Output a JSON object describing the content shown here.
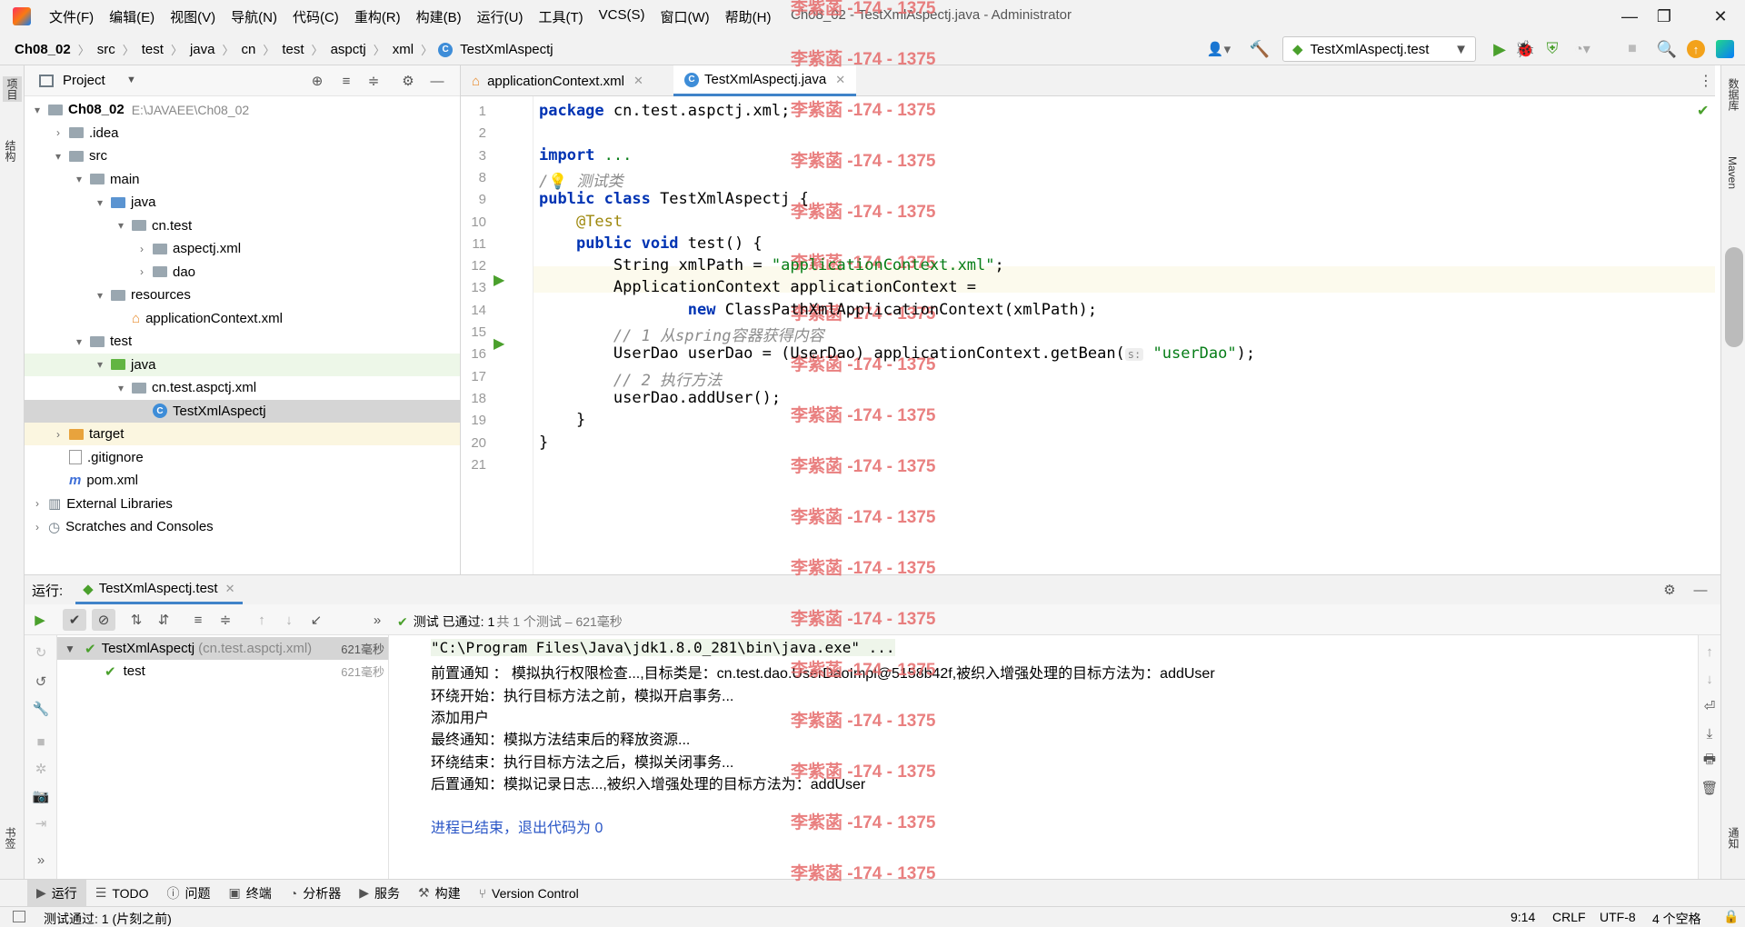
{
  "titlebar": {
    "menu": [
      "文件(F)",
      "编辑(E)",
      "视图(V)",
      "导航(N)",
      "代码(C)",
      "重构(R)",
      "构建(B)",
      "运行(U)",
      "工具(T)",
      "VCS(S)",
      "窗口(W)",
      "帮助(H)"
    ],
    "window_title": "Ch08_02 - TestXmlAspectj.java - Administrator"
  },
  "navbar": {
    "breadcrumbs": [
      "Ch08_02",
      "src",
      "test",
      "java",
      "cn",
      "test",
      "aspctj",
      "xml",
      "TestXmlAspectj"
    ],
    "run_config": "TestXmlAspectj.test"
  },
  "left_stripe": {
    "project_tab": "项目",
    "structure_tab": "结构",
    "bookmarks_tab": "书签"
  },
  "right_stripe": {
    "database_tab": "数据库",
    "maven_tab": "Maven",
    "notifications_tab": "通知"
  },
  "project": {
    "header": "Project",
    "tree": [
      {
        "label": "Ch08_02",
        "extra": "E:\\JAVAEE\\Ch08_02",
        "level": 0,
        "arrow": "down",
        "icon": "module-folder",
        "bold": true
      },
      {
        "label": ".idea",
        "level": 1,
        "arrow": "right",
        "icon": "folder"
      },
      {
        "label": "src",
        "level": 1,
        "arrow": "down",
        "icon": "folder"
      },
      {
        "label": "main",
        "level": 2,
        "arrow": "down",
        "icon": "folder"
      },
      {
        "label": "java",
        "level": 3,
        "arrow": "down",
        "icon": "source-folder"
      },
      {
        "label": "cn.test",
        "level": 4,
        "arrow": "down",
        "icon": "package"
      },
      {
        "label": "aspectj.xml",
        "level": 5,
        "arrow": "right",
        "icon": "package"
      },
      {
        "label": "dao",
        "level": 5,
        "arrow": "right",
        "icon": "package"
      },
      {
        "label": "resources",
        "level": 3,
        "arrow": "down",
        "icon": "resources-folder"
      },
      {
        "label": "applicationContext.xml",
        "level": 4,
        "arrow": "",
        "icon": "xml-file"
      },
      {
        "label": "test",
        "level": 2,
        "arrow": "down",
        "icon": "folder"
      },
      {
        "label": "java",
        "level": 3,
        "arrow": "down",
        "icon": "test-folder",
        "highlight": "green"
      },
      {
        "label": "cn.test.aspctj.xml",
        "level": 4,
        "arrow": "down",
        "icon": "package"
      },
      {
        "label": "TestXmlAspectj",
        "level": 5,
        "arrow": "",
        "icon": "java-class",
        "selected": true
      },
      {
        "label": "target",
        "level": 1,
        "arrow": "right",
        "icon": "excluded-folder",
        "highlight": "yellow"
      },
      {
        "label": ".gitignore",
        "level": 1,
        "arrow": "",
        "icon": "file"
      },
      {
        "label": "pom.xml",
        "level": 1,
        "arrow": "",
        "icon": "maven-file"
      },
      {
        "label": "External Libraries",
        "level": 0,
        "arrow": "right",
        "icon": "libraries"
      },
      {
        "label": "Scratches and Consoles",
        "level": 0,
        "arrow": "right",
        "icon": "scratches"
      }
    ]
  },
  "editor": {
    "tabs": [
      {
        "label": "applicationContext.xml",
        "active": false
      },
      {
        "label": "TestXmlAspectj.java",
        "active": true
      }
    ],
    "lines": [
      {
        "num": "1",
        "parts": [
          {
            "t": "package ",
            "c": "kw"
          },
          {
            "t": "cn.test.aspctj.xml;",
            "c": ""
          }
        ]
      },
      {
        "num": "2",
        "parts": []
      },
      {
        "num": "3",
        "parts": [
          {
            "t": "import ",
            "c": "kw"
          },
          {
            "t": "...",
            "c": "str"
          }
        ]
      },
      {
        "num": "8",
        "parts": [
          {
            "t": "/",
            "c": "cmt"
          },
          {
            "t": "💡",
            "c": ""
          },
          {
            "t": " 测试类",
            "c": "cmt"
          }
        ]
      },
      {
        "num": "9",
        "parts": [
          {
            "t": "public class ",
            "c": "kw"
          },
          {
            "t": "TestXmlAspectj {",
            "c": ""
          }
        ]
      },
      {
        "num": "10",
        "parts": [
          {
            "t": "    ",
            "c": ""
          },
          {
            "t": "@Test",
            "c": "ann"
          }
        ]
      },
      {
        "num": "11",
        "parts": [
          {
            "t": "    ",
            "c": ""
          },
          {
            "t": "public void ",
            "c": "kw"
          },
          {
            "t": "test() {",
            "c": ""
          }
        ]
      },
      {
        "num": "12",
        "parts": [
          {
            "t": "        String xmlPath = ",
            "c": ""
          },
          {
            "t": "\"applicationContext.xml\"",
            "c": "str"
          },
          {
            "t": ";",
            "c": ""
          }
        ]
      },
      {
        "num": "13",
        "parts": [
          {
            "t": "        ApplicationContext applicationContext =",
            "c": ""
          }
        ]
      },
      {
        "num": "14",
        "parts": [
          {
            "t": "                ",
            "c": ""
          },
          {
            "t": "new ",
            "c": "kw"
          },
          {
            "t": "ClassPathXmlApplicationContext(xmlPath);",
            "c": ""
          }
        ]
      },
      {
        "num": "15",
        "parts": [
          {
            "t": "        // 1 从spring容器获得内容",
            "c": "cmt"
          }
        ]
      },
      {
        "num": "16",
        "parts": [
          {
            "t": "        UserDao userDao = (UserDao) applicationContext.getBean(",
            "c": ""
          },
          {
            "t": "s:",
            "c": "hint"
          },
          {
            "t": " ",
            "c": ""
          },
          {
            "t": "\"userDao\"",
            "c": "str"
          },
          {
            "t": ");",
            "c": ""
          }
        ]
      },
      {
        "num": "17",
        "parts": [
          {
            "t": "        // 2 执行方法",
            "c": "cmt"
          }
        ]
      },
      {
        "num": "18",
        "parts": [
          {
            "t": "        userDao.addUser();",
            "c": ""
          }
        ]
      },
      {
        "num": "19",
        "parts": [
          {
            "t": "    }",
            "c": ""
          }
        ]
      },
      {
        "num": "20",
        "parts": [
          {
            "t": "}",
            "c": ""
          }
        ]
      },
      {
        "num": "21",
        "parts": []
      }
    ]
  },
  "run": {
    "label": "运行:",
    "tab": "TestXmlAspectj.test",
    "status_prefix": "测试 已通过:",
    "status_count": "1",
    "status_suffix": "共 1 个测试 – 621毫秒",
    "tests": [
      {
        "name": "TestXmlAspectj",
        "detail": "(cn.test.aspctj.xml)",
        "time": "621毫秒"
      },
      {
        "name": "test",
        "detail": "",
        "time": "621毫秒"
      }
    ],
    "console": [
      {
        "text": "\"C:\\Program Files\\Java\\jdk1.8.0_281\\bin\\java.exe\" ...",
        "style": "cmd"
      },
      {
        "text": "前置通知 ： 模拟执行权限检查...,目标类是：cn.test.dao.UserDaoImpl@5158b42f,被织入增强处理的目标方法为：addUser",
        "style": ""
      },
      {
        "text": "环绕开始：执行目标方法之前，模拟开启事务...",
        "style": ""
      },
      {
        "text": "添加用户",
        "style": ""
      },
      {
        "text": "最终通知：模拟方法结束后的释放资源...",
        "style": ""
      },
      {
        "text": "环绕结束：执行目标方法之后，模拟关闭事务...",
        "style": ""
      },
      {
        "text": "后置通知：模拟记录日志...,被织入增强处理的目标方法为：addUser",
        "style": ""
      },
      {
        "text": "",
        "style": ""
      },
      {
        "text": "进程已结束，退出代码为 0",
        "style": "exit"
      }
    ]
  },
  "bottom_tools": [
    "运行",
    "TODO",
    "问题",
    "终端",
    "分析器",
    "服务",
    "构建",
    "Version Control"
  ],
  "statusbar": {
    "message": "测试通过: 1 (片刻之前)",
    "position": "9:14",
    "line_sep": "CRLF",
    "encoding": "UTF-8",
    "indent": "4 个空格"
  },
  "watermark": "李紫菡 -174 - 1375",
  "colors": {
    "accent": "#4083c9",
    "keyword": "#0033b3",
    "string": "#067d17",
    "comment": "#8c8c8c",
    "watermark": "#e66a6a",
    "pass": "#4aa02c"
  }
}
